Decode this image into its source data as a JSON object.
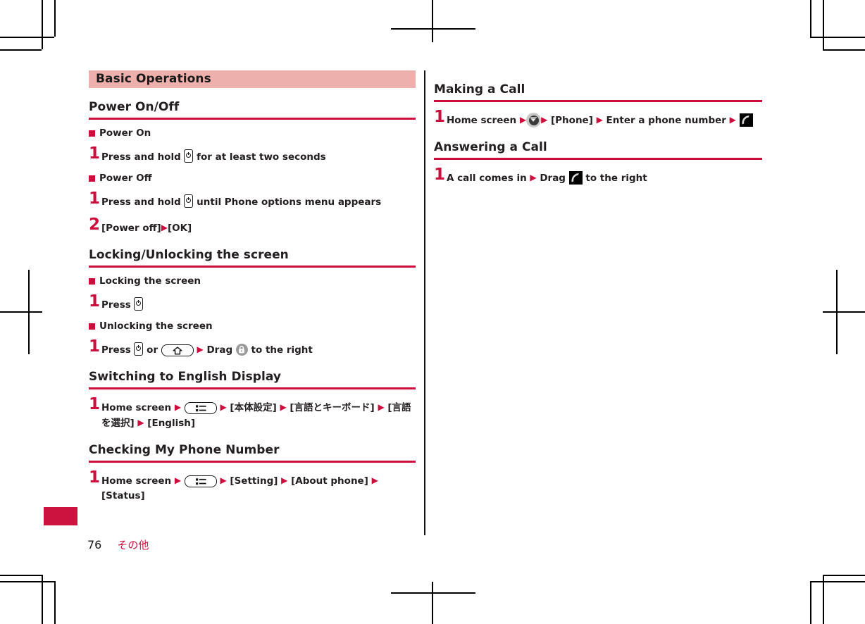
{
  "chapter": {
    "title": "Basic Operations"
  },
  "footer": {
    "page_number": "76",
    "chapter_jp": "その他"
  },
  "left_column": {
    "sections": [
      {
        "heading": "Power On/Off",
        "blocks": [
          {
            "type": "subhead",
            "text": "Power On"
          },
          {
            "type": "step",
            "number": "1",
            "parts": [
              {
                "t": "text",
                "v": "Press and hold "
              },
              {
                "t": "icon",
                "v": "power-key-icon"
              },
              {
                "t": "text",
                "v": " for at least two seconds"
              }
            ]
          },
          {
            "type": "subhead",
            "text": "Power Off"
          },
          {
            "type": "step",
            "number": "1",
            "parts": [
              {
                "t": "text",
                "v": "Press and hold "
              },
              {
                "t": "icon",
                "v": "power-key-icon"
              },
              {
                "t": "text",
                "v": " until Phone options menu appears"
              }
            ]
          },
          {
            "type": "step",
            "number": "2",
            "parts": [
              {
                "t": "text",
                "v": "[Power off]"
              },
              {
                "t": "arrow",
                "v": "▶"
              },
              {
                "t": "text",
                "v": "[OK]"
              }
            ]
          }
        ]
      },
      {
        "heading": "Locking/Unlocking the screen",
        "blocks": [
          {
            "type": "subhead",
            "text": "Locking the screen"
          },
          {
            "type": "step",
            "number": "1",
            "parts": [
              {
                "t": "text",
                "v": "Press "
              },
              {
                "t": "icon",
                "v": "power-key-icon"
              }
            ]
          },
          {
            "type": "subhead",
            "text": "Unlocking the screen"
          },
          {
            "type": "step",
            "number": "1",
            "parts": [
              {
                "t": "text",
                "v": "Press "
              },
              {
                "t": "icon",
                "v": "power-key-icon"
              },
              {
                "t": "text",
                "v": " or "
              },
              {
                "t": "icon",
                "v": "home-key-icon"
              },
              {
                "t": "text",
                "v": " "
              },
              {
                "t": "arrow",
                "v": "▶"
              },
              {
                "t": "text",
                "v": " Drag "
              },
              {
                "t": "icon",
                "v": "lock-icon"
              },
              {
                "t": "text",
                "v": " to the right"
              }
            ]
          }
        ]
      },
      {
        "heading": "Switching to English Display",
        "blocks": [
          {
            "type": "step",
            "number": "1",
            "parts": [
              {
                "t": "text",
                "v": "Home screen "
              },
              {
                "t": "arrow",
                "v": "▶"
              },
              {
                "t": "text",
                "v": " "
              },
              {
                "t": "icon",
                "v": "menu-key-icon"
              },
              {
                "t": "text",
                "v": " "
              },
              {
                "t": "arrow",
                "v": "▶"
              },
              {
                "t": "text",
                "v": " [本体設定] "
              },
              {
                "t": "arrow",
                "v": "▶"
              },
              {
                "t": "text",
                "v": " [言語とキーボード] "
              },
              {
                "t": "arrow",
                "v": "▶"
              },
              {
                "t": "text",
                "v": " [言語を選択] "
              },
              {
                "t": "arrow",
                "v": "▶"
              },
              {
                "t": "text",
                "v": " [English]"
              }
            ]
          }
        ]
      },
      {
        "heading": "Checking My Phone Number",
        "blocks": [
          {
            "type": "step",
            "number": "1",
            "parts": [
              {
                "t": "text",
                "v": "Home screen "
              },
              {
                "t": "arrow",
                "v": "▶"
              },
              {
                "t": "text",
                "v": " "
              },
              {
                "t": "icon",
                "v": "menu-key-icon"
              },
              {
                "t": "text",
                "v": " "
              },
              {
                "t": "arrow",
                "v": "▶"
              },
              {
                "t": "text",
                "v": " [Setting] "
              },
              {
                "t": "arrow",
                "v": "▶"
              },
              {
                "t": "text",
                "v": " [About phone] "
              },
              {
                "t": "arrow",
                "v": "▶"
              },
              {
                "t": "text",
                "v": " [Status]"
              }
            ]
          }
        ]
      }
    ]
  },
  "right_column": {
    "sections": [
      {
        "heading": "Making a Call",
        "blocks": [
          {
            "type": "step",
            "number": "1",
            "parts": [
              {
                "t": "text",
                "v": "Home screen "
              },
              {
                "t": "arrow",
                "v": "▶"
              },
              {
                "t": "icon",
                "v": "app-launcher-icon"
              },
              {
                "t": "arrow",
                "v": "▶"
              },
              {
                "t": "text",
                "v": " [Phone] "
              },
              {
                "t": "arrow",
                "v": "▶"
              },
              {
                "t": "text",
                "v": " Enter a phone number "
              },
              {
                "t": "arrow",
                "v": "▶"
              },
              {
                "t": "text",
                "v": " "
              },
              {
                "t": "icon",
                "v": "call-icon"
              }
            ]
          }
        ]
      },
      {
        "heading": "Answering a Call",
        "blocks": [
          {
            "type": "step",
            "number": "1",
            "parts": [
              {
                "t": "text",
                "v": "A call comes in "
              },
              {
                "t": "arrow",
                "v": "▶"
              },
              {
                "t": "text",
                "v": " Drag "
              },
              {
                "t": "icon",
                "v": "answer-call-icon"
              },
              {
                "t": "text",
                "v": " to the right"
              }
            ]
          }
        ]
      }
    ]
  },
  "colors": {
    "accent_red": "#cc0e3d",
    "chapter_bar_bg": "#eeb0ac",
    "tab_marker": "#cc1340",
    "text": "#231f20"
  }
}
